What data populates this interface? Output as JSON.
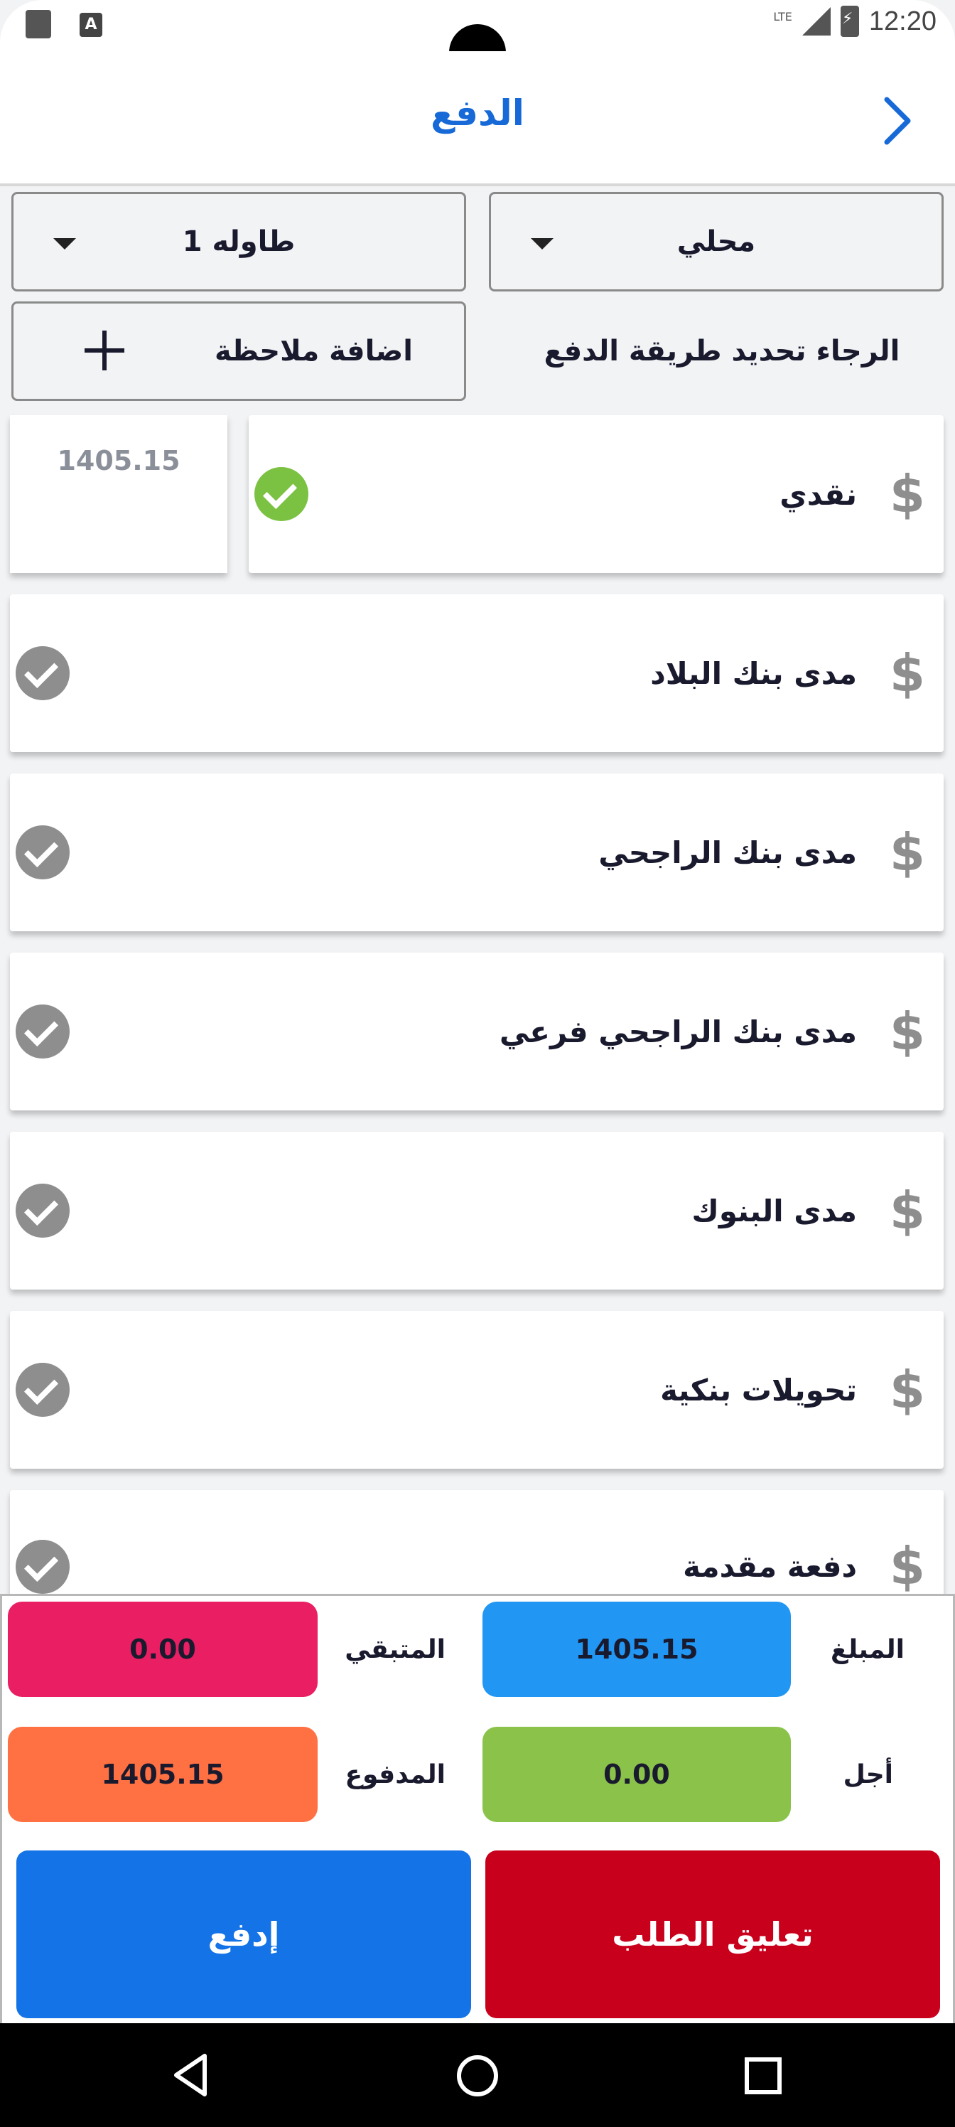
{
  "status_bar": {
    "time": "12:20",
    "network": "LTE",
    "notif_icon_letter": "A"
  },
  "header": {
    "title": "الدفع"
  },
  "order_type": {
    "selected": "محلي"
  },
  "table_select": {
    "selected": "طاوله 1"
  },
  "payment_prompt": "الرجاء تحديد طريقة الدفع",
  "add_note_label": "اضافة ملاحظة",
  "payment_methods": [
    {
      "label": "نقدي",
      "selected": true,
      "amount": "1405.15"
    },
    {
      "label": "مدى بنك البلاد",
      "selected": false
    },
    {
      "label": "مدى بنك الراجحي",
      "selected": false
    },
    {
      "label": "مدى بنك الراجحي فرعي",
      "selected": false
    },
    {
      "label": "مدى البنوك",
      "selected": false
    },
    {
      "label": "تحويلات بنكية",
      "selected": false
    },
    {
      "label": "دفعة مقدمة",
      "selected": false
    }
  ],
  "currency_symbol": "$",
  "summary": {
    "amount_label": "المبلغ",
    "amount_value": "1405.15",
    "remaining_label": "المتبقي",
    "remaining_value": "0.00",
    "deferred_label": "أجل",
    "deferred_value": "0.00",
    "paid_label": "المدفوع",
    "paid_value": "1405.15"
  },
  "actions": {
    "suspend_label": "تعليق الطلب",
    "pay_label": "إدفع"
  },
  "colors": {
    "accent": "#1669d6",
    "amount": "#2196f3",
    "remaining": "#e91e63",
    "deferred": "#8bc34a",
    "paid": "#ff7043",
    "suspend": "#c8001c",
    "pay": "#1473e6",
    "check_on": "#7cc242",
    "check_off": "#8e8e8e"
  }
}
